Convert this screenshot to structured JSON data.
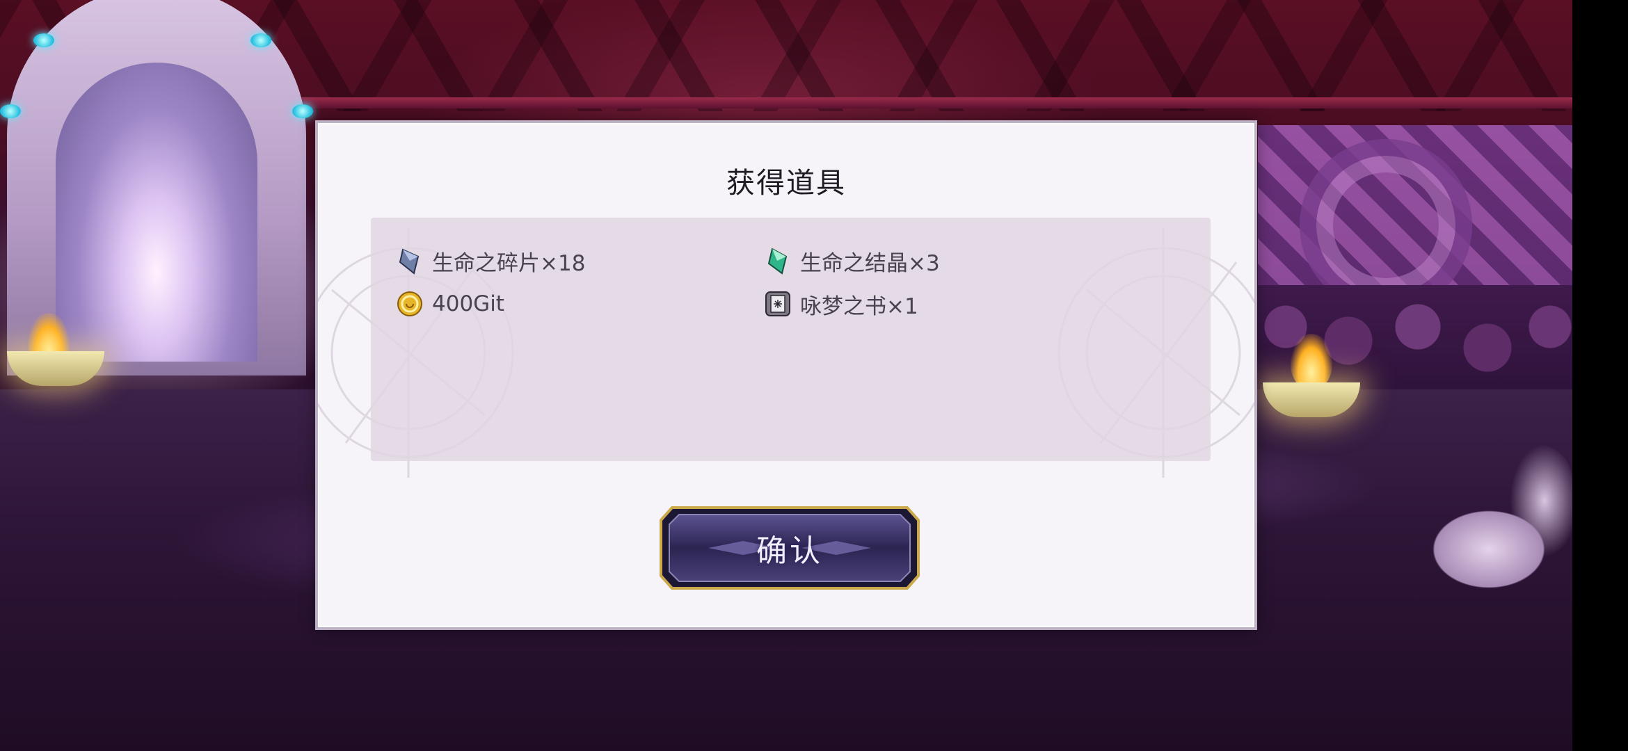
{
  "dialog": {
    "title": "获得道具",
    "confirm_label": "确认"
  },
  "rewards": [
    {
      "icon": "blue-crystal-shard-icon",
      "label": "生命之碎片×18"
    },
    {
      "icon": "green-crystal-icon",
      "label": "生命之结晶×3"
    },
    {
      "icon": "gold-coin-icon",
      "label": "400Git"
    },
    {
      "icon": "dream-book-icon",
      "label": "咏梦之书×1"
    }
  ],
  "colors": {
    "panel_bg": "#f7f4f9",
    "items_bg": "#e0d6e2",
    "button_face": "#3d3566",
    "button_border": "#c9a94a"
  }
}
